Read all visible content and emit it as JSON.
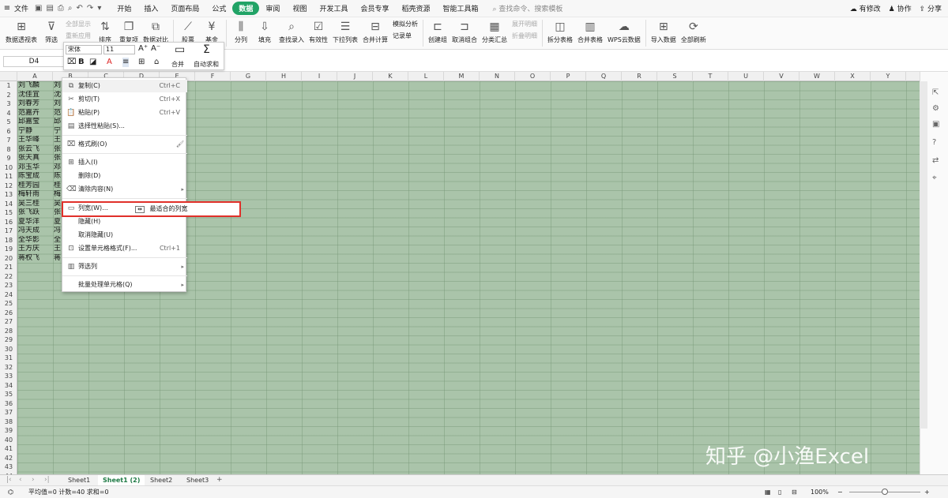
{
  "menubar": {
    "file": "文件",
    "tabs": [
      "开始",
      "插入",
      "页面布局",
      "公式",
      "数据",
      "审阅",
      "视图",
      "开发工具",
      "会员专享",
      "稻壳资源",
      "智能工具箱"
    ],
    "active_tab": "数据",
    "search": "查找命令、搜索模板",
    "right": [
      "有修改",
      "协作",
      "分享"
    ]
  },
  "ribbon": {
    "b1": "数据透视表",
    "b2": "筛选",
    "s1a": "全部显示",
    "s1b": "重新应用",
    "b3": "排序",
    "b4": "重复项",
    "b5": "数据对比",
    "b6": "股票",
    "b7": "基金",
    "b8": "分列",
    "b9": "填充",
    "b10": "查找录入",
    "b11": "有效性",
    "b12": "下拉列表",
    "b13": "合并计算",
    "s2a": "模拟分析",
    "s2b": "记录单",
    "b14": "创建组",
    "b15": "取消组合",
    "b16": "分类汇总",
    "s3a": "展开明细",
    "s3b": "折叠明细",
    "b17": "拆分表格",
    "b18": "合并表格",
    "b19": "WPS云数据",
    "b20": "导入数据",
    "b21": "全部刷新"
  },
  "namebox": "D4",
  "minitoolbar": {
    "font": "宋体",
    "size": "11",
    "merge": "合并",
    "autosum": "自动求和"
  },
  "columns": [
    "A",
    "B",
    "C",
    "D",
    "E",
    "F",
    "G",
    "H",
    "I",
    "J",
    "K",
    "L",
    "M",
    "N",
    "O",
    "P",
    "Q",
    "R",
    "S",
    "T",
    "U",
    "V",
    "W",
    "X",
    "Y"
  ],
  "rows": [
    "1",
    "2",
    "3",
    "4",
    "5",
    "6",
    "7",
    "8",
    "9",
    "10",
    "11",
    "12",
    "13",
    "14",
    "15",
    "16",
    "17",
    "18",
    "19",
    "20",
    "21",
    "22",
    "23",
    "24",
    "25",
    "26",
    "27",
    "28",
    "29",
    "30",
    "31",
    "32",
    "33",
    "34",
    "35",
    "36",
    "37",
    "38",
    "39",
    "40",
    "41",
    "42",
    "43",
    "44"
  ],
  "colA": [
    "刘飞麟",
    "沈佳宜",
    "刘春芳",
    "范嘉卉",
    "邱嘉莹",
    "宁静",
    "王华峰",
    "张云飞",
    "张天真",
    "邓玉华",
    "陈宝成",
    "桂芳园",
    "梅轩雨",
    "吴三桂",
    "张飞跃",
    "夏华洋",
    "冯天成",
    "全华影",
    "王方庆",
    "蒋权飞"
  ],
  "colB": [
    "刘",
    "沈",
    "刘",
    "范",
    "邱",
    "宁",
    "王",
    "张",
    "张",
    "邓",
    "陈",
    "桂",
    "梅",
    "吴",
    "张",
    "夏",
    "冯",
    "全",
    "王",
    "蒋"
  ],
  "context_menu": {
    "copy": "复制(C)",
    "copy_sc": "Ctrl+C",
    "cut": "剪切(T)",
    "cut_sc": "Ctrl+X",
    "paste": "粘贴(P)",
    "paste_sc": "Ctrl+V",
    "paste_special": "选择性粘贴(S)...",
    "format_painter": "格式刷(O)",
    "insert": "插入(I)",
    "delete": "删除(D)",
    "clear": "清除内容(N)",
    "col_width": "列宽(W)...",
    "hide": "隐藏(H)",
    "unhide": "取消隐藏(U)",
    "format_cells": "设置单元格格式(F)...",
    "format_cells_sc": "Ctrl+1",
    "filter_col": "筛选列",
    "batch": "批量处理单元格(Q)"
  },
  "submenu": {
    "best_fit": "最适合的列宽"
  },
  "sheets": [
    "Sheet1",
    "Sheet1 (2)",
    "Sheet2",
    "Sheet3"
  ],
  "active_sheet": "Sheet1 (2)",
  "status": {
    "text": "平均值=0  计数=40  求和=0",
    "zoom": "100%"
  },
  "watermark": "知乎 @小渔Excel",
  "colors": {
    "accent": "#21a366",
    "cell_bg": "#aac4aa",
    "highlight": "#e0302a"
  }
}
